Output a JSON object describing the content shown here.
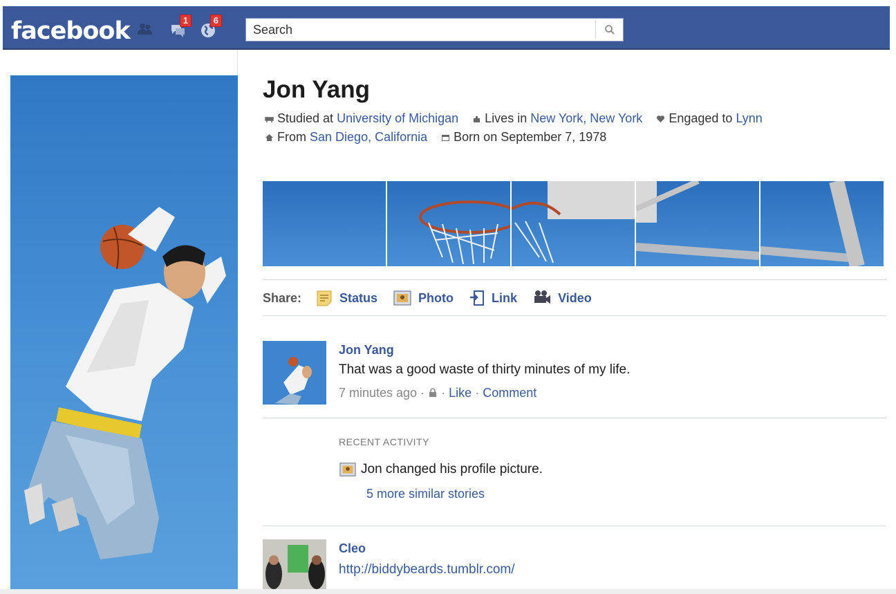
{
  "header": {
    "logo": "facebook",
    "friend_requests_count": "",
    "messages_count": "1",
    "notifications_count": "6",
    "search_placeholder": "Search"
  },
  "profile": {
    "name": "Jon Yang",
    "info_line1": {
      "studied_prefix": "Studied at",
      "school": "University of Michigan",
      "lives_prefix": "Lives in",
      "city": "New York, New York",
      "engaged_prefix": "Engaged to",
      "partner": "Lynn"
    },
    "info_line2": {
      "from_prefix": "From",
      "hometown": "San Diego, California",
      "born": "Born on September 7, 1978"
    }
  },
  "share": {
    "label": "Share:",
    "items": [
      {
        "label": "Status",
        "icon": "status-icon"
      },
      {
        "label": "Photo",
        "icon": "photo-icon"
      },
      {
        "label": "Link",
        "icon": "link-icon"
      },
      {
        "label": "Video",
        "icon": "video-icon"
      }
    ]
  },
  "stories": [
    {
      "actor": "Jon Yang",
      "message": "That was a good waste of thirty minutes of my life.",
      "time": "7 minutes ago",
      "separator": "·",
      "like": "Like",
      "comment": "Comment"
    },
    {
      "actor": "Cleo",
      "message": "http://biddybeards.tumblr.com/"
    }
  ],
  "recent_activity": {
    "title": "RECENT ACTIVITY",
    "text": "Jon changed his profile picture.",
    "more": "5 more similar stories"
  },
  "colors": {
    "brand_blue": "#3b5998",
    "link_blue": "#3b5998",
    "badge_red": "#e43633",
    "sky_blue": "#4a8fd5"
  }
}
